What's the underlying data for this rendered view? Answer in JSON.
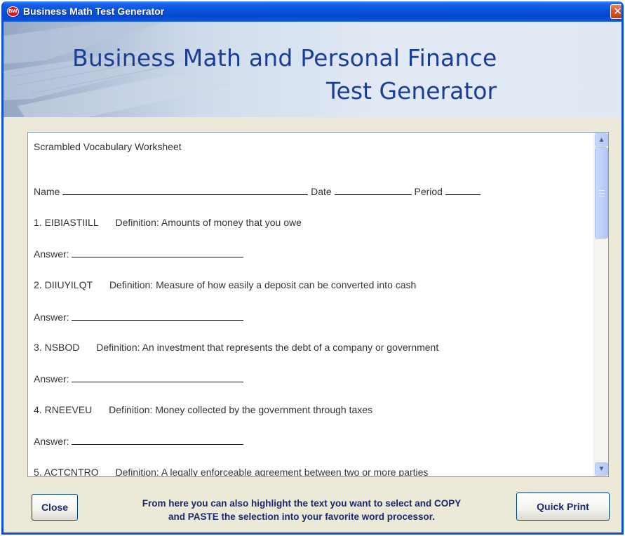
{
  "window": {
    "title": "Business Math Test Generator",
    "app_icon_text": "BW",
    "close_glyph": "✕"
  },
  "banner": {
    "line1": "Business Math and Personal Finance",
    "line2": "Test Generator"
  },
  "worksheet": {
    "heading": "Scrambled Vocabulary Worksheet",
    "name_label": "Name",
    "date_label": "Date",
    "period_label": "Period",
    "answer_label": "Answer:",
    "items": [
      {
        "number": "1.",
        "scrambled": "EIBIASTIILL",
        "definition_label": "Definition:",
        "definition": "Amounts of money that you owe"
      },
      {
        "number": "2.",
        "scrambled": "DIIUYILQT",
        "definition_label": "Definition:",
        "definition": "Measure of how easily a deposit can be converted into cash"
      },
      {
        "number": "3.",
        "scrambled": "NSBOD",
        "definition_label": "Definition:",
        "definition": "An investment that represents the debt of a company or government"
      },
      {
        "number": "4.",
        "scrambled": "RNEEVEU",
        "definition_label": "Definition:",
        "definition": "Money collected by the government through taxes"
      },
      {
        "number": "5.",
        "scrambled": "ACTCNTRO",
        "definition_label": "Definition:",
        "definition": "A legally enforceable agreement between two or more parties"
      }
    ]
  },
  "scrollbar": {
    "up_glyph": "▲",
    "down_glyph": "▼",
    "position_fraction": 0.0
  },
  "footer": {
    "close_label": "Close",
    "hint_line1": "From here you can also highlight the text you want to select and COPY",
    "hint_line2": "and PASTE the selection into your favorite word processor.",
    "print_label": "Quick Print"
  },
  "colors": {
    "titlebar": "#0a55e0",
    "banner_text": "#1b3d9a",
    "window_bg": "#ece9d8",
    "button_text": "#1d2a6e"
  }
}
